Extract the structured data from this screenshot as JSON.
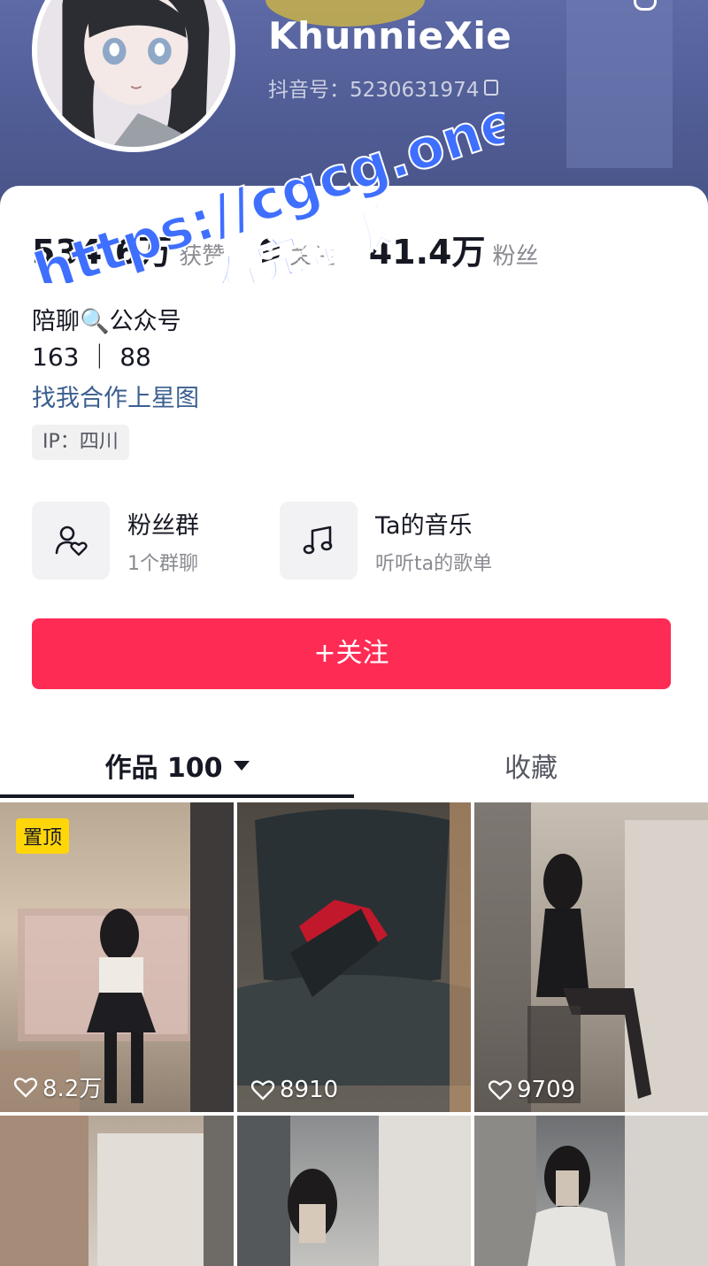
{
  "profile": {
    "username": "KhunnieXie",
    "douyin_id_label": "抖音号：5230631974",
    "stats": [
      {
        "value": "534.6万",
        "label": "获赞"
      },
      {
        "value": "9",
        "label": "关注"
      },
      {
        "value": "41.4万",
        "label": "粉丝"
      }
    ],
    "bio_line1": "陪聊🔍公众号",
    "bio_line2": "163 ｜ 88",
    "cooperation_link": "找我合作上星图",
    "ip": "IP：四川"
  },
  "features": [
    {
      "title": "粉丝群",
      "subtitle": "1个群聊",
      "icon": "user-heart-icon"
    },
    {
      "title": "Ta的音乐",
      "subtitle": "听听ta的歌单",
      "icon": "music-note-icon"
    }
  ],
  "follow_button": "+关注",
  "tabs": {
    "works": "作品 100",
    "favorites": "收藏"
  },
  "videos": [
    {
      "likes": "8.2万",
      "pinned": "置顶"
    },
    {
      "likes": "8910"
    },
    {
      "likes": "9709"
    },
    {
      "likes": ""
    },
    {
      "likes": ""
    },
    {
      "likes": ""
    }
  ],
  "watermark": {
    "line1": "https://cgcg.one",
    "line2": "看完整版"
  },
  "colors": {
    "accent": "#fe2c55",
    "link": "#3b5f8f",
    "pin": "#ffd60a",
    "watermark": "#3f6fff"
  }
}
